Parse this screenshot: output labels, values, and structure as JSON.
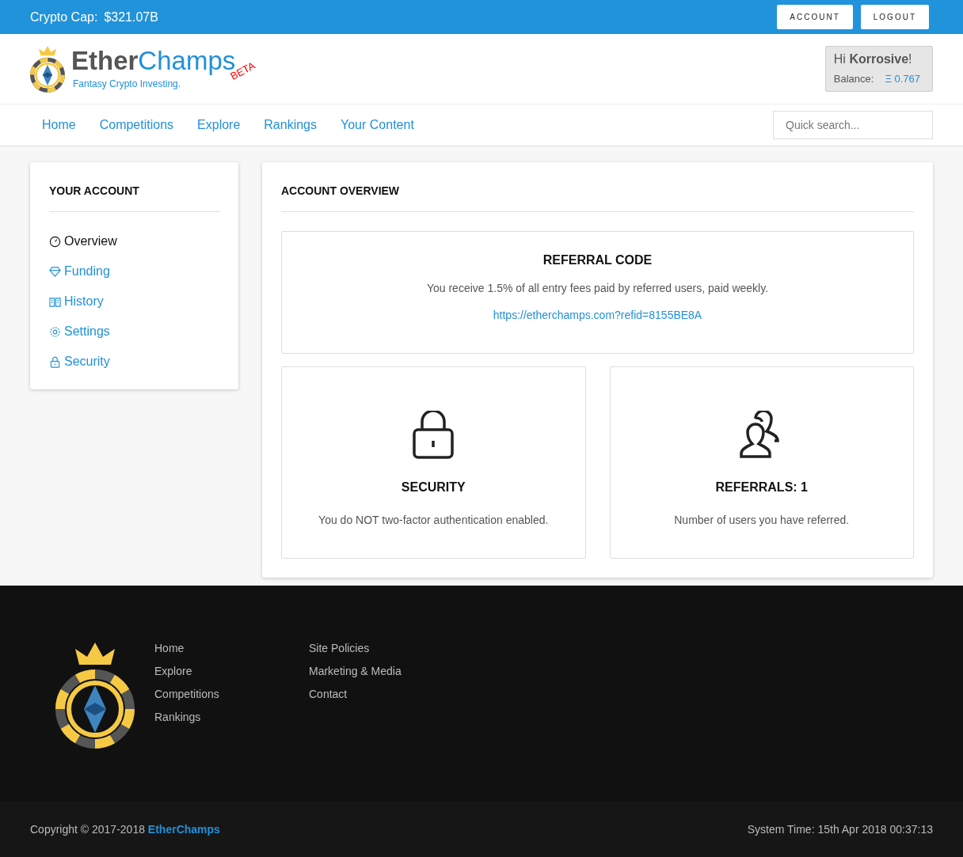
{
  "top_bar": {
    "cap_label": "Crypto Cap:",
    "cap_value": "$321.07B",
    "buttons": [
      "ACCOUNT",
      "LOGOUT"
    ]
  },
  "brand": {
    "first": "Ether",
    "second": "Champs",
    "beta": "BETA",
    "tagline": "Fantasy Crypto Investing."
  },
  "user_box": {
    "greeting": "Hi **Korrosive**!",
    "balance_label": "Balance:",
    "balance_value": "Ξ 0.767"
  },
  "nav": {
    "items": [
      "Home",
      "Competitions",
      "Explore",
      "Rankings",
      "Your Content"
    ],
    "search": {
      "placeholder": "Quick search..."
    }
  },
  "sidebar": {
    "title": "YOUR ACCOUNT",
    "items": [
      {
        "label": "Overview",
        "kind": "gauge",
        "selected": true
      },
      {
        "label": "Funding",
        "kind": "diamond",
        "selected": false
      },
      {
        "label": "History",
        "kind": "book",
        "selected": false
      },
      {
        "label": "Settings",
        "kind": "gear",
        "selected": false
      },
      {
        "label": "Security",
        "kind": "lock",
        "selected": false
      }
    ]
  },
  "overview": {
    "title": "ACCOUNT OVERVIEW",
    "referral": {
      "title": "REFERRAL CODE",
      "text": "You receive 1.5% of all entry fees paid by referred users, paid weekly.",
      "link": "https://etherchamps.com?refid=8155BE8A"
    },
    "cards": [
      {
        "kind": "lock",
        "title": "SECURITY",
        "text": "You do NOT two-factor authentication enabled."
      },
      {
        "kind": "users",
        "title": "REFERRALS: 1",
        "text": "Number of users you have referred."
      }
    ]
  },
  "footer": {
    "columns": [
      [
        "Home",
        "Explore",
        "Competitions",
        "Rankings"
      ],
      [
        "Site Policies",
        "Marketing & Media",
        "Contact"
      ]
    ],
    "copyright": "Copyright © 2017-2018",
    "copyright_link": "EtherChamps",
    "system_time": "System Time: 15th Apr 2018 00:37:13"
  }
}
